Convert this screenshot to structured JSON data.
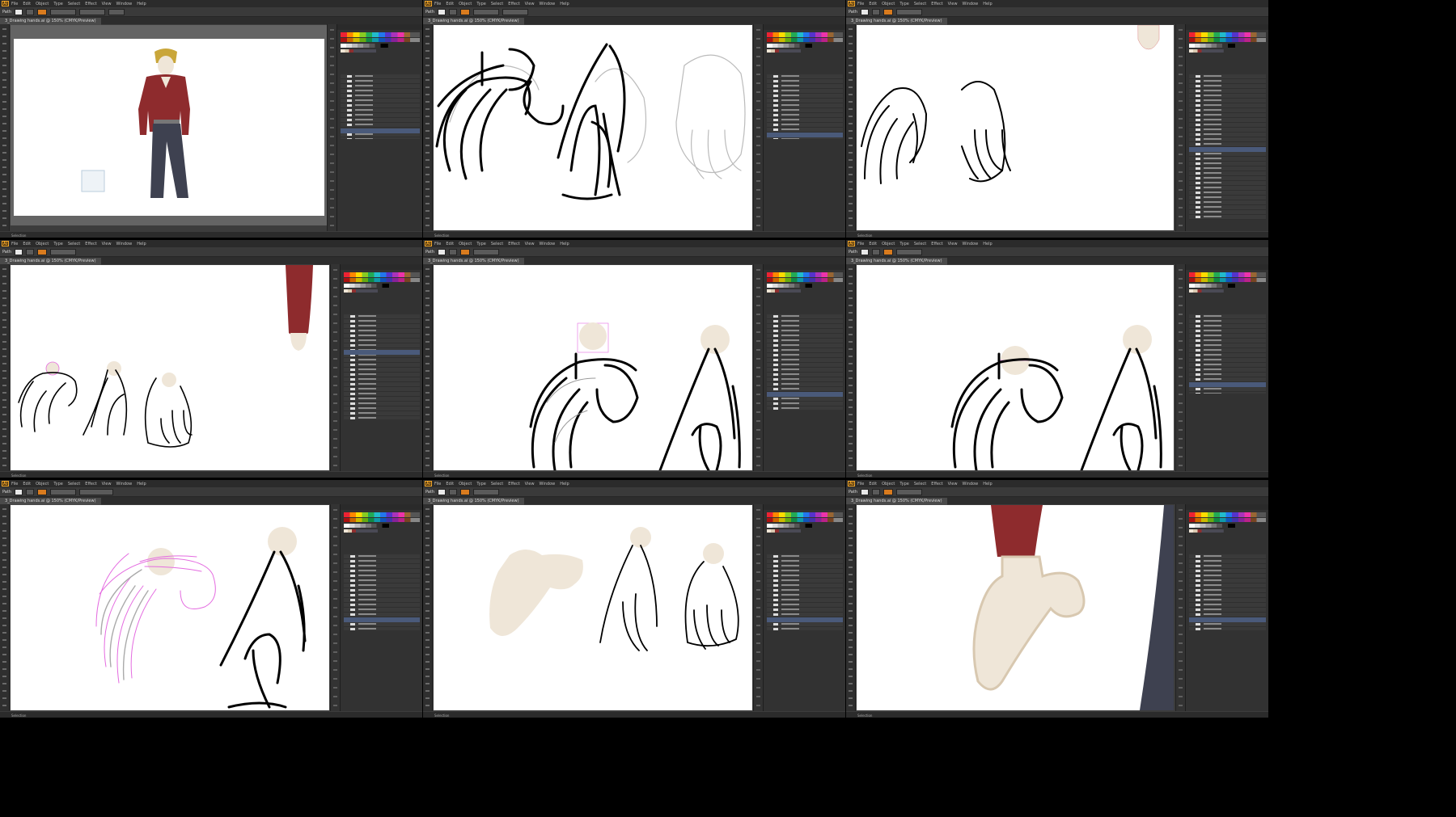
{
  "app": {
    "logo": "Ai",
    "menu": [
      "File",
      "Edit",
      "Object",
      "Type",
      "Select",
      "Effect",
      "View",
      "Window",
      "Help"
    ],
    "mode_label": "Essentials",
    "ctrl_selection": "Path",
    "doc_tab_label": "3_Drawing hands.ai @ 150% (CMYK/Preview)",
    "status_tool": "Selection"
  },
  "panes": [
    {
      "id": "p1",
      "content": "full figure in red shirt and dark pants"
    },
    {
      "id": "p2",
      "content": "three hand sketches"
    },
    {
      "id": "p3",
      "content": "two hand sketches"
    },
    {
      "id": "p4",
      "content": "three sketches with red sleeve"
    },
    {
      "id": "p5",
      "content": "hand sketches with tan circles"
    },
    {
      "id": "p6",
      "content": "hand sketches with tan circles"
    },
    {
      "id": "p7",
      "content": "pink selected hand paths"
    },
    {
      "id": "p8",
      "content": "tan hand shape and sketches"
    },
    {
      "id": "p9",
      "content": "final colored hand with red sleeve"
    }
  ],
  "colors": {
    "skin": "#efe6d8",
    "shirt": "#8e2b2d",
    "pants": "#3e4150",
    "hair": "#c9a63a",
    "ui_dark": "#3c3c3c",
    "selection": "#e46be0"
  }
}
